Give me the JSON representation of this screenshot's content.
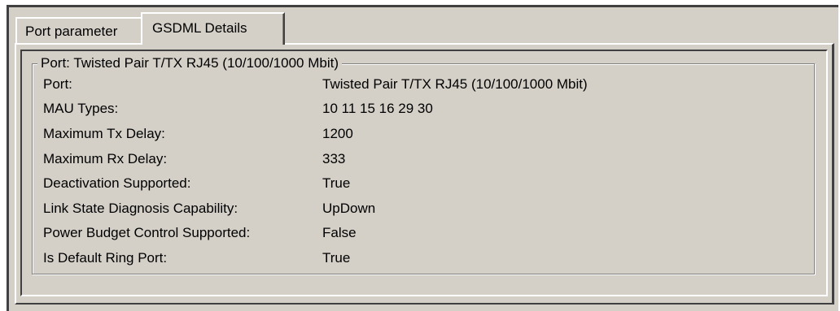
{
  "tabs": [
    {
      "label": "Port parameter",
      "active": false
    },
    {
      "label": "GSDML Details",
      "active": true
    }
  ],
  "group": {
    "title": "Port: Twisted Pair T/TX RJ45 (10/100/1000 Mbit)",
    "rows": [
      {
        "label": "Port:",
        "value": "Twisted Pair T/TX RJ45 (10/100/1000 Mbit)"
      },
      {
        "label": "MAU Types:",
        "value": "10 11 15 16 29 30"
      },
      {
        "label": "Maximum Tx Delay:",
        "value": "1200"
      },
      {
        "label": "Maximum Rx Delay:",
        "value": "333"
      },
      {
        "label": "Deactivation Supported:",
        "value": "True"
      },
      {
        "label": "Link State Diagnosis Capability:",
        "value": "UpDown"
      },
      {
        "label": "Power Budget Control Supported:",
        "value": "False"
      },
      {
        "label": "Is Default Ring Port:",
        "value": "True"
      }
    ]
  },
  "colors": {
    "face": "#d4d0c8",
    "shadow": "#808080",
    "dark_shadow": "#404040",
    "highlight": "#ffffff",
    "text": "#000000"
  }
}
